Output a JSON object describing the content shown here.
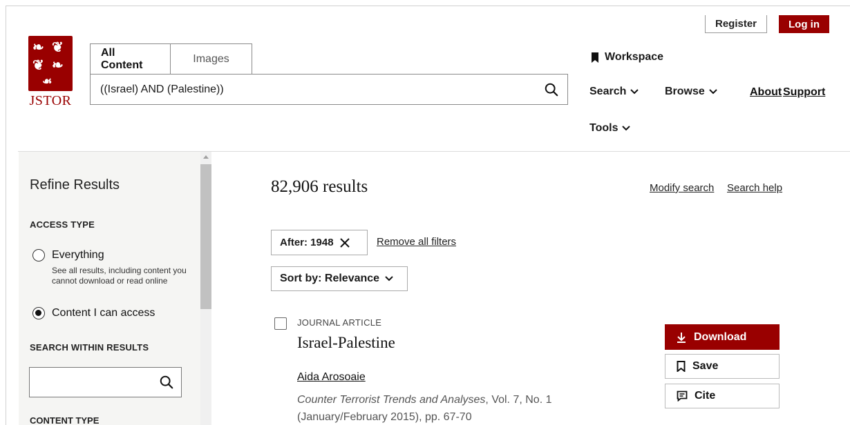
{
  "brand": {
    "name": "JSTOR",
    "color": "#990000"
  },
  "header": {
    "register_label": "Register",
    "login_label": "Log in",
    "workspace_label": "Workspace",
    "tabs": [
      {
        "label": "All Content",
        "active": true
      },
      {
        "label": "Images",
        "active": false
      }
    ],
    "search_value": "((Israel) AND (Palestine))",
    "nav": {
      "search": "Search",
      "browse": "Browse",
      "about": "About",
      "support": "Support",
      "tools": "Tools"
    }
  },
  "sidebar": {
    "title": "Refine Results",
    "access_heading": "ACCESS TYPE",
    "options": [
      {
        "label": "Everything",
        "description": "See all results, including content you cannot download or read online",
        "checked": false
      },
      {
        "label": "Content I can access",
        "checked": true
      }
    ],
    "search_within_heading": "SEARCH WITHIN RESULTS",
    "search_within_value": "",
    "content_type_heading": "CONTENT TYPE"
  },
  "main": {
    "results_count": "82,906 results",
    "modify_search": "Modify search",
    "search_help": "Search help",
    "filter_chip": "After: 1948",
    "remove_filters": "Remove all filters",
    "sort_label": "Sort by: Relevance",
    "results": [
      {
        "type": "JOURNAL ARTICLE",
        "title": "Israel-Palestine",
        "author": "Aida Arosoaie",
        "journal": "Counter Terrorist Trends and Analyses",
        "citation": ", Vol. 7, No. 1",
        "date_pages": "(January/February 2015), pp. 67-70",
        "actions": {
          "download": "Download",
          "save": "Save",
          "cite": "Cite"
        }
      }
    ]
  }
}
